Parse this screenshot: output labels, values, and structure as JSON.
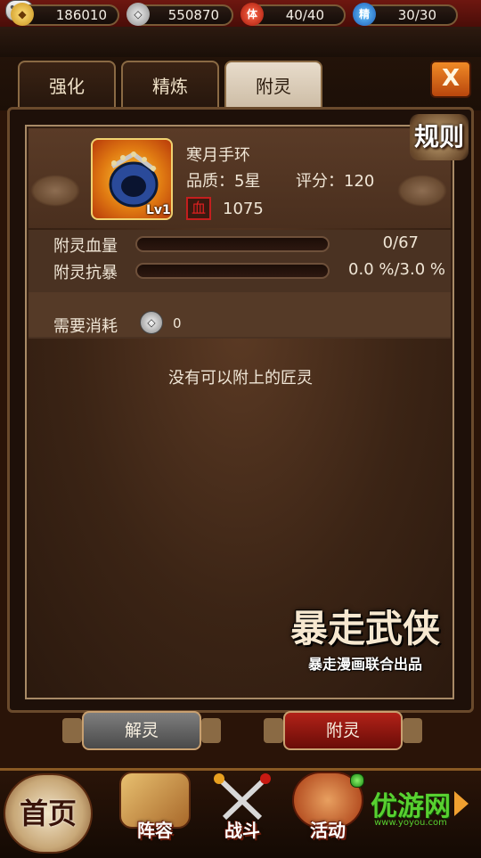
{
  "resources": {
    "gold": {
      "value": "186010",
      "icon": "gold-ingot-icon"
    },
    "silver": {
      "value": "550870",
      "icon": "silver-coin-icon"
    },
    "stamina": {
      "value": "40/40",
      "icon_label": "体"
    },
    "spirit": {
      "value": "30/30",
      "icon_label": "精"
    }
  },
  "tabs": [
    {
      "label": "强化",
      "active": false
    },
    {
      "label": "精炼",
      "active": false
    },
    {
      "label": "附灵",
      "active": true
    }
  ],
  "close_label": "X",
  "rules_label": "规则",
  "item": {
    "name": "寒月手环",
    "level": "Lv1",
    "quality": "品质：5星",
    "score": "评分：120",
    "hp_icon_label": "血",
    "hp_value": "1075"
  },
  "stats": [
    {
      "label": "附灵血量",
      "value": "0/67",
      "progress": 0
    },
    {
      "label": "附灵抗暴",
      "value": "0.0 %/3.0 %",
      "progress": 0
    }
  ],
  "cost": {
    "label": "需要消耗",
    "value": "0"
  },
  "empty_message": "没有可以附上的匠灵",
  "logo": {
    "main": "暴走武侠",
    "sub": "暴走漫画联合出品"
  },
  "buttons": {
    "detach": "解灵",
    "attach": "附灵"
  },
  "nav": {
    "home": "首页",
    "items": [
      {
        "label": "阵容",
        "icon": "formation-board-icon"
      },
      {
        "label": "战斗",
        "icon": "swords-icon"
      },
      {
        "label": "活动",
        "icon": "lantern-icon"
      }
    ]
  },
  "watermark": {
    "main": "优游网",
    "sub": "www.yoyou.com"
  },
  "colors": {
    "accent_orange": "#e8761a",
    "panel_brown": "#3b2415",
    "attach_red": "#9a1a12"
  }
}
